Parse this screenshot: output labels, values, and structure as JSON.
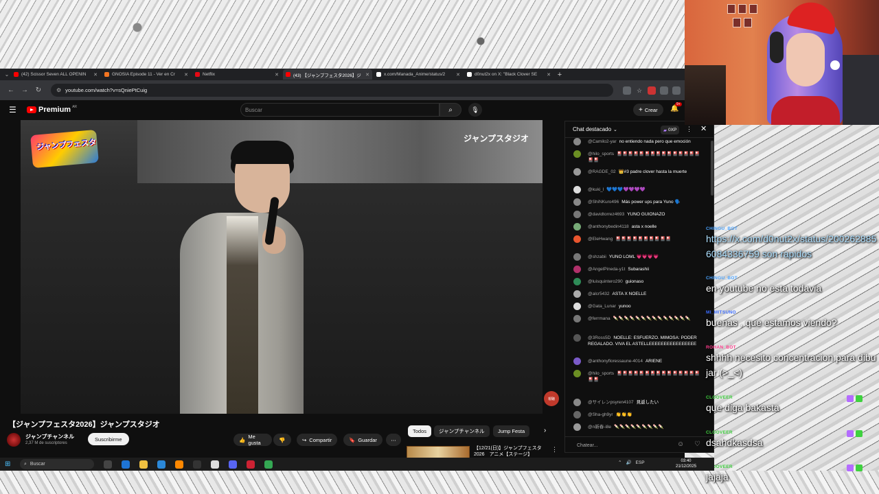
{
  "browser": {
    "tabs": [
      {
        "label": "(42) Scissor Seven ALL OPENIN",
        "color": "#ff0000",
        "active": false
      },
      {
        "label": "GNOSIA Episode 11 - Ver en Cr",
        "color": "#f47521",
        "active": false
      },
      {
        "label": "Netflix",
        "color": "#e50914",
        "active": false
      },
      {
        "label": "(43) 【ジャンプフェスタ2026】ジ",
        "color": "#ff0000",
        "active": true
      },
      {
        "label": "x.com/Manada_Anime/status/2",
        "color": "#ffffff",
        "active": false
      },
      {
        "label": "d0nut2x on X: \"Black Clover SE",
        "color": "#ffffff",
        "active": false
      }
    ],
    "url": "youtube.com/watch?v=sQniePtCuig"
  },
  "youtube": {
    "brand": "Premium",
    "brand_region": "AR",
    "search_placeholder": "Buscar",
    "create_label": "Crear",
    "notif_count": "9+",
    "video_overlay_text": "ジャンプスタジオ",
    "logo_text": "ジャンプフェスタ",
    "side_badge": "視聴",
    "video_title": "【ジャンプフェスタ2026】ジャンプスタジオ",
    "channel_name": "ジャンプチャンネル",
    "subscribers": "2,37 M de suscriptores",
    "subscribe_label": "Suscribirme",
    "like_label": "Me gusta",
    "share_label": "Compartir",
    "save_label": "Guardar",
    "chips": [
      "Todos",
      "ジャンプチャンネル",
      "Jump Festa"
    ],
    "reco_title": "【12/21(日)】ジャンプフェスタ 2026　アニメ【ステージ】"
  },
  "chat": {
    "title": "Chat destacado",
    "xp": "0XP",
    "input_placeholder": "Chatear...",
    "messages": [
      {
        "author": "@Camilo2-yar",
        "text": "no entiendo nada pero que emoción",
        "color": "#888"
      },
      {
        "author": "@hilo_sports",
        "text": "🎴🎴🎴🎴🎴🎴🎴🎴🎴🎴🎴🎴🎴🎴🎴🎴🎴",
        "color": "#6b8e23"
      },
      {
        "author": "@RAGDE_02",
        "text": "👑#3 padre clover hasta la muerte",
        "color": "#999"
      },
      {
        "author": "@kuki_l",
        "text": "💙💙💙💜💜💜💜",
        "color": "#ddd"
      },
      {
        "author": "@ShiNKuro496",
        "text": "Más power ups para Yuno 🗣️",
        "color": "#888"
      },
      {
        "author": "@davidtorrez4693",
        "text": "YUNO GUIONAZO",
        "color": "#777"
      },
      {
        "author": "@anthonybedin4118",
        "text": "asta x noelle",
        "color": "#7a7"
      },
      {
        "author": "@EleHwang",
        "text": "🎴🎴🎴🎴🎴🎴🎴🎴🎴🎴",
        "color": "#e8552e"
      },
      {
        "author": "@shzabii",
        "text": "YUNO LOML 💗💗💗💗",
        "color": "#777"
      },
      {
        "author": "@AngelPineda-y1t",
        "text": "Subarashii",
        "color": "#b0306a"
      },
      {
        "author": "@luisquintero290",
        "text": "guionaso",
        "color": "#2e8b57"
      },
      {
        "author": "@alcr5432",
        "text": "ASTA X NOELLE",
        "color": "#aaa"
      },
      {
        "author": "@Gata_Lunar",
        "text": "yunoo",
        "color": "#ddd"
      },
      {
        "author": "@ferrmana",
        "text": "🍡🍡🍡🍡🍡🍡🍡🍡🍡🍡🍡🍡🍡🍡",
        "color": "#777"
      },
      {
        "author": "@3Ross5D",
        "text": "NOELLE: ESFUERZO. MIMOSA: PODER REGALADO. VIVA EL ASTELLEEEEEEEEEEEEEEEE",
        "color": "#555"
      },
      {
        "author": "@anthonyfloressaune-4014",
        "text": "ARIENE",
        "color": "#7a5ac8"
      },
      {
        "author": "@hilo_sports",
        "text": "🎴🎴🎴🎴🎴🎴🎴🎴🎴🎴🎴🎴🎴🎴🎴🎴🎴",
        "color": "#6b8e23"
      },
      {
        "author": "@サイレンpsyren4107",
        "text": "見返したい",
        "color": "#888"
      },
      {
        "author": "@Sha-gh9yr",
        "text": "👏👏👏",
        "color": "#666"
      },
      {
        "author": "@n新春-i8e",
        "text": "🍡🍡🍡🍡🍡🍡🍡🍡🍡",
        "color": "#999"
      }
    ]
  },
  "overlay": {
    "messages": [
      {
        "name": "CHINGU_BOT",
        "name_color": "#4aa3ff",
        "text": "https://x.com/d0nut2x/status/2002628856084336759 son rapidos",
        "is_link": true
      },
      {
        "name": "CHINGU_BOT",
        "name_color": "#4aa3ff",
        "text": "en youtube no esta todavia",
        "is_link": false
      },
      {
        "name": "MI_MITSUNO",
        "name_color": "#3b6cff",
        "text": "buenas , que estamos viendo?",
        "is_link": false
      },
      {
        "name": "ROHAN_BOT",
        "name_color": "#ff3b8b",
        "text": "shhhh necesito concentracion para dibujar (>_<)",
        "is_link": false
      },
      {
        "name": "CLOOVEER",
        "name_color": "#3fd13f",
        "text": "que diga bakasta",
        "is_link": false
      },
      {
        "name": "CLOOVEER",
        "name_color": "#3fd13f",
        "text": "dsahdkasdsa",
        "is_link": false
      },
      {
        "name": "CLOOVEER",
        "name_color": "#3fd13f",
        "text": "jajaja",
        "is_link": false
      }
    ]
  },
  "taskbar": {
    "search_placeholder": "Buscar",
    "lang": "ESP",
    "time": "03:40",
    "date": "21/12/2025"
  }
}
